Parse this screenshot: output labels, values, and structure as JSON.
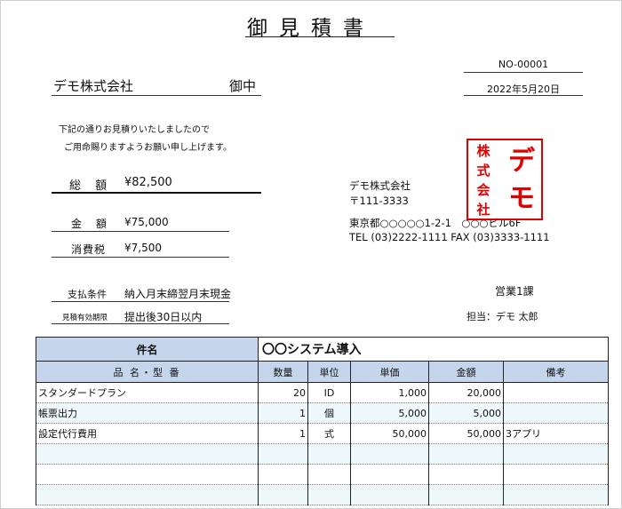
{
  "document": {
    "title": "御見積書",
    "number": "NO-00001",
    "date": "2022年5月20日",
    "client_name": "デモ株式会社",
    "client_suffix": "御中",
    "message_line1": "下記の通りお見積りいたしましたので",
    "message_line2": "ご用命賜りますようお願い申し上げます。",
    "total_label": "総 額",
    "total_value": "¥82,500",
    "amount_label": "金 額",
    "amount_value": "¥75,000",
    "tax_label": "消費税",
    "tax_value": "¥7,500",
    "payment_label": "支払条件",
    "payment_value": "納入月末締翌月末現金",
    "validity_label": "見積有効期限",
    "validity_value": "提出後30日以内"
  },
  "issuer": {
    "name": "デモ株式会社",
    "postal": "〒111-3333",
    "address": "東京都○○○○○1-2-1　○○○ビル6F",
    "contact": "TEL (03)2222-1111 FAX (03)3333-1111",
    "stamp_small": [
      "株",
      "式",
      "会",
      "社"
    ],
    "stamp_big": [
      "デ",
      "モ"
    ],
    "stamp_color": "#e00000",
    "department": "営業1課",
    "person": "担当：デモ 太郎"
  },
  "table": {
    "subject_label": "件名",
    "subject_value": "〇〇システム導入",
    "headers": [
      "品 名・型 番",
      "数量",
      "単位",
      "単価",
      "金額",
      "備考"
    ],
    "rows": [
      [
        "スタンダードプラン",
        "20",
        "ID",
        "1,000",
        "20,000",
        ""
      ],
      [
        "帳票出力",
        "1",
        "個",
        "5,000",
        "5,000",
        ""
      ],
      [
        "設定代行費用",
        "1",
        "式",
        "50,000",
        "50,000",
        "3アプリ"
      ],
      [
        "",
        "",
        "",
        "",
        "",
        ""
      ],
      [
        "",
        "",
        "",
        "",
        "",
        ""
      ],
      [
        "",
        "",
        "",
        "",
        "",
        ""
      ]
    ],
    "header_color": "#c5d6ec",
    "alt_row_color": "#eef8fb"
  }
}
